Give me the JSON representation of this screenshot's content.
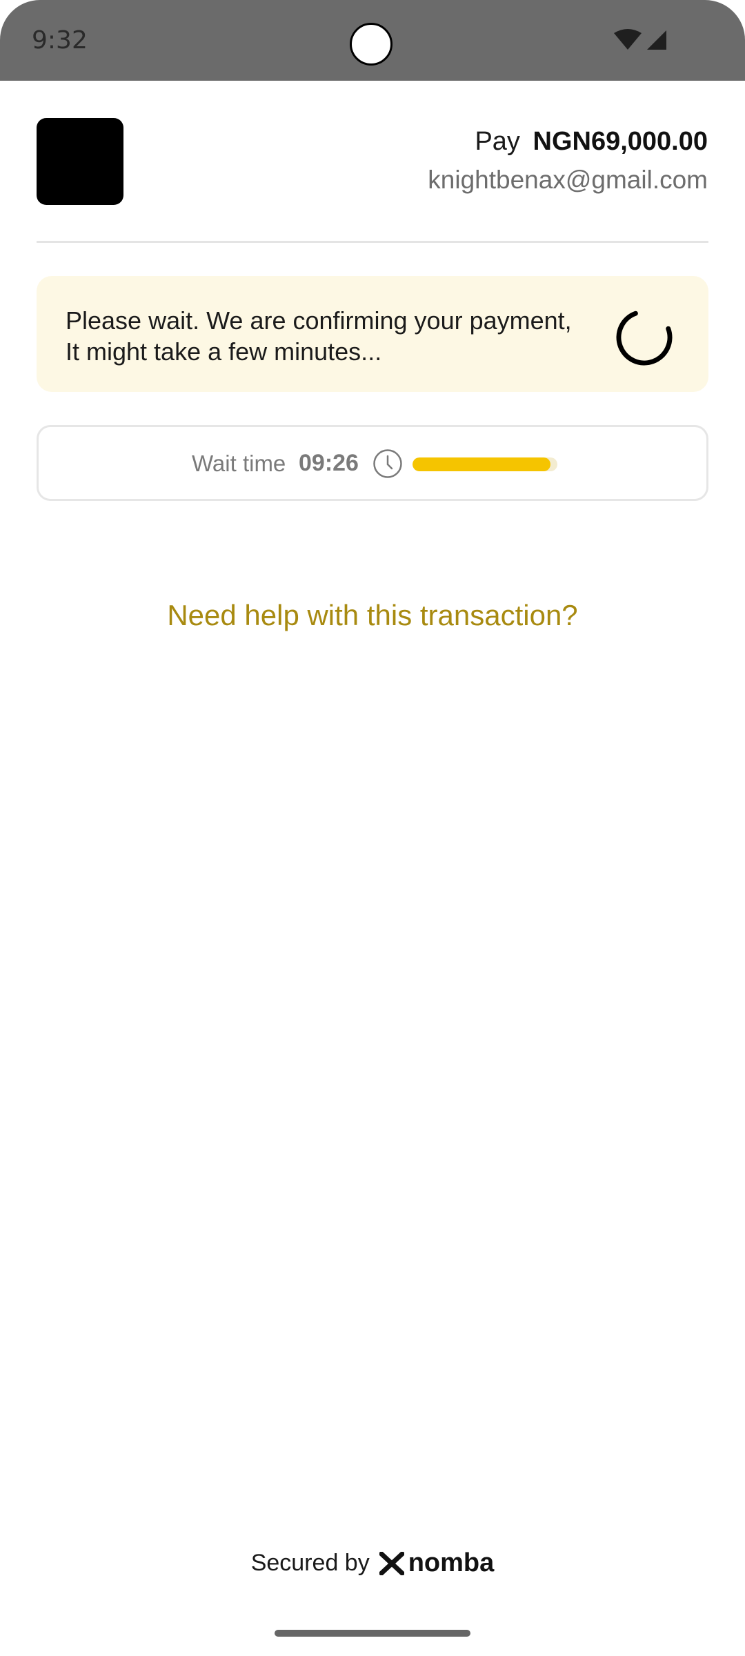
{
  "status_bar": {
    "time": "9:32",
    "icons": [
      "wifi-icon",
      "cellular-signal-icon"
    ]
  },
  "header": {
    "pay_label": "Pay",
    "amount": "NGN69,000.00",
    "email": "knightbenax@gmail.com"
  },
  "notice": {
    "text": "Please wait. We are confirming your payment, It might take a few minutes...",
    "icon": "loading-spinner-icon",
    "background_color": "#fdf8e4"
  },
  "wait": {
    "label": "Wait time",
    "time": "09:26",
    "icon": "clock-icon",
    "progress": 0.95,
    "progress_color": "#f5c400"
  },
  "help": {
    "link_text": "Need help with this transaction?",
    "color": "#a88a10"
  },
  "footer": {
    "secured_label": "Secured by",
    "brand": "nomba"
  }
}
